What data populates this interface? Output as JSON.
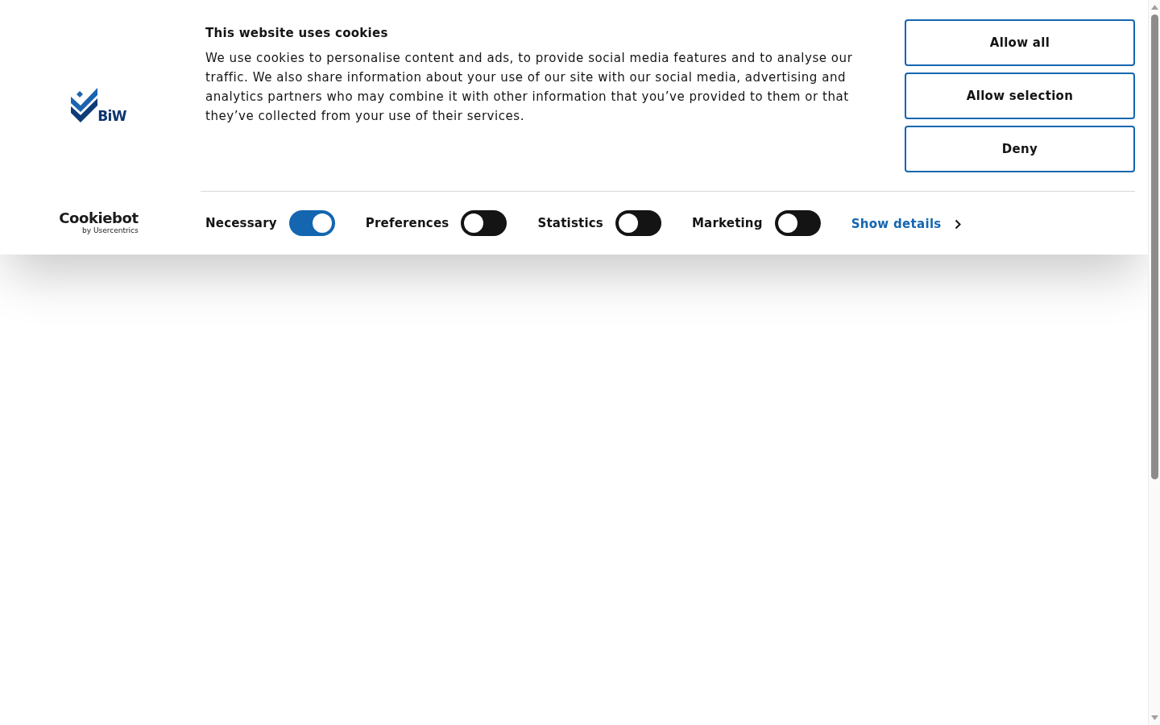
{
  "logo": {
    "text": "BiW"
  },
  "banner": {
    "title": "This website uses cookies",
    "body": "We use cookies to personalise content and ads, to provide social media features and to analyse our traffic. We also share information about your use of our site with our social media, advertising and analytics partners who may combine it with other information that you’ve provided to them or that they’ve collected from your use of their services."
  },
  "buttons": [
    "Allow all",
    "Allow selection",
    "Deny"
  ],
  "provider": {
    "name": "Cookiebot",
    "tagline": "by Usercentrics"
  },
  "categories": [
    {
      "label": "Necessary",
      "checked": true
    },
    {
      "label": "Preferences",
      "checked": false
    },
    {
      "label": "Statistics",
      "checked": false
    },
    {
      "label": "Marketing",
      "checked": false
    }
  ],
  "details_link": {
    "label": "Show details"
  }
}
